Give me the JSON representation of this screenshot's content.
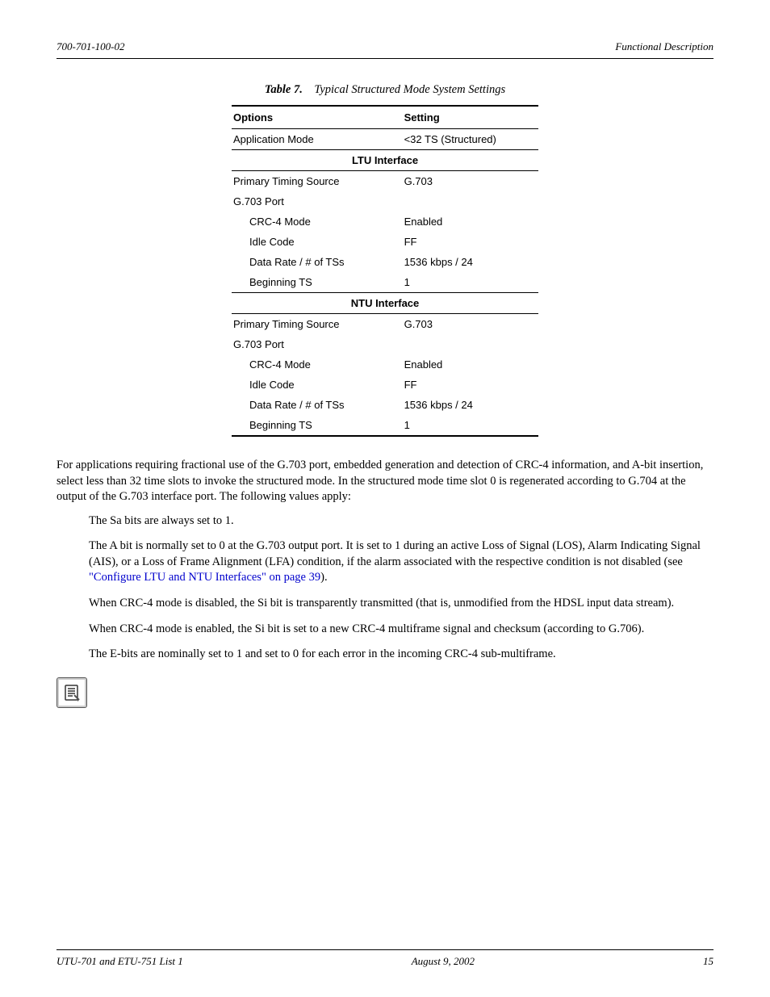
{
  "header": {
    "left": "700-701-100-02",
    "right": "Functional Description"
  },
  "table": {
    "label": "Table 7.",
    "title": "Typical Structured Mode System Settings",
    "columns": [
      "Options",
      "Setting"
    ],
    "row_app": {
      "opt": "Application Mode",
      "set": "<32 TS (Structured)"
    },
    "section_ltu": "LTU Interface",
    "ltu": {
      "r1": {
        "opt": "Primary Timing Source",
        "set": "G.703"
      },
      "r2": {
        "opt": "G.703 Port",
        "set": ""
      },
      "r3": {
        "opt": "CRC-4 Mode",
        "set": "Enabled"
      },
      "r4": {
        "opt": "Idle Code",
        "set": "FF"
      },
      "r5": {
        "opt": "Data Rate / # of TSs",
        "set": "1536 kbps / 24"
      },
      "r6": {
        "opt": "Beginning TS",
        "set": "1"
      }
    },
    "section_ntu": "NTU Interface",
    "ntu": {
      "r1": {
        "opt": "Primary Timing Source",
        "set": "G.703"
      },
      "r2": {
        "opt": "G.703 Port",
        "set": ""
      },
      "r3": {
        "opt": "CRC-4 Mode",
        "set": "Enabled"
      },
      "r4": {
        "opt": "Idle Code",
        "set": "FF"
      },
      "r5": {
        "opt": "Data Rate / # of TSs",
        "set": "1536 kbps / 24"
      },
      "r6": {
        "opt": "Beginning TS",
        "set": "1"
      }
    }
  },
  "para1": "For applications requiring fractional use of the G.703 port, embedded generation and detection of CRC-4 information, and A-bit insertion, select less than 32 time slots to invoke the structured mode. In the structured mode time slot 0 is regenerated according to G.704 at the output of the G.703 interface port. The following values apply:",
  "bullets": {
    "b1": "The Sa bits are always set to 1.",
    "b2a": "The A bit is normally set to 0 at the G.703 output port. It is set to 1 during an active Loss of Signal (LOS), Alarm Indicating Signal (AIS), or a Loss of Frame Alignment (LFA) condition, if the alarm associated with the respective condition is not disabled (see ",
    "b2link": "\"Configure LTU and NTU Interfaces\" on page 39",
    "b2b": ").",
    "b3": "When CRC-4 mode is disabled, the Si bit is transparently transmitted (that is, unmodified from the HDSL input data stream).",
    "b4": "When CRC-4 mode is enabled, the Si bit is set to a new CRC-4 multiframe signal and checksum (according to G.706).",
    "b5": "The E-bits are nominally set to 1 and set to 0 for each error in the incoming CRC-4 sub-multiframe."
  },
  "footer": {
    "left": "UTU-701 and ETU-751 List 1",
    "center": "August 9, 2002",
    "right": "15"
  }
}
